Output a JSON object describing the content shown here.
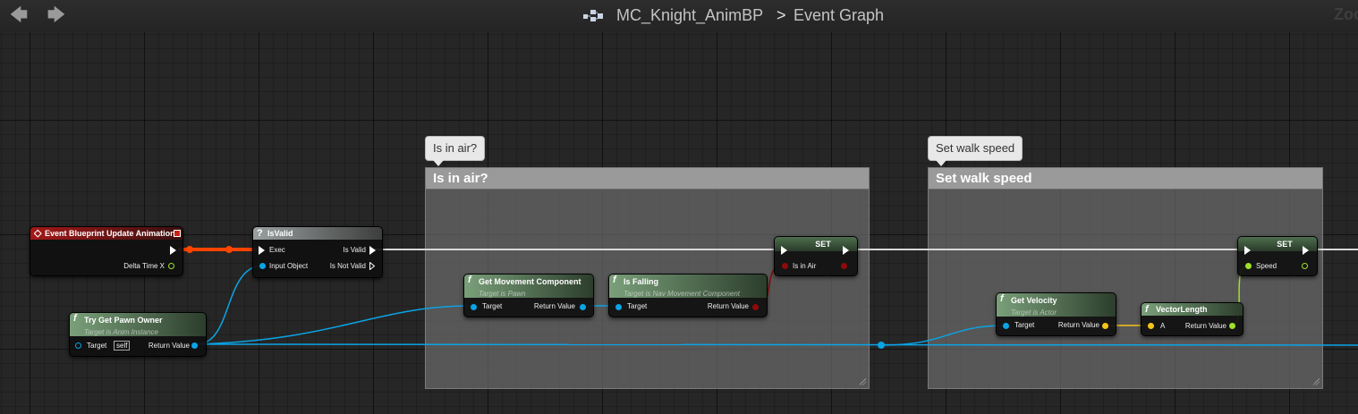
{
  "toolbar": {
    "back_icon": "back-arrow-icon",
    "forward_icon": "forward-arrow-icon",
    "breadcrumb": {
      "blueprint_icon": "blueprint-icon",
      "asset": "MC_Knight_AnimBP",
      "separator": ">",
      "graph": "Event Graph"
    },
    "zoom_text": "Zoo"
  },
  "comments": [
    {
      "bubble": "Is in air?",
      "title": "Is in air?"
    },
    {
      "bubble": "Set walk speed",
      "title": "Set walk speed"
    }
  ],
  "nodes": {
    "event": {
      "title": "Event Blueprint Update Animation",
      "pin_delta": "Delta Time X"
    },
    "isvalid": {
      "icon": "?",
      "title": "IsValid",
      "pin_exec": "Exec",
      "pin_input": "Input Object",
      "pin_valid": "Is Valid",
      "pin_not_valid": "Is Not Valid"
    },
    "pawn_owner": {
      "icon": "f",
      "title": "Try Get Pawn Owner",
      "subtitle": "Target is Anim Instance",
      "pin_target": "Target",
      "self_label": "self",
      "pin_return": "Return Value"
    },
    "get_movement": {
      "icon": "f",
      "title": "Get Movement Component",
      "subtitle": "Target is Pawn",
      "pin_target": "Target",
      "pin_return": "Return Value"
    },
    "is_falling": {
      "icon": "f",
      "title": "Is Falling",
      "subtitle": "Target is Nav Movement Component",
      "pin_target": "Target",
      "pin_return": "Return Value"
    },
    "set_air": {
      "title": "SET",
      "pin_var": "Is in Air"
    },
    "get_velocity": {
      "icon": "f",
      "title": "Get Velocity",
      "subtitle": "Target is Actor",
      "pin_target": "Target",
      "pin_return": "Return Value"
    },
    "vector_length": {
      "icon": "f",
      "title": "VectorLength",
      "pin_a": "A",
      "pin_return": "Return Value"
    },
    "set_speed": {
      "title": "SET",
      "pin_var": "Speed"
    }
  },
  "colors": {
    "exec_wire": "#ffffff",
    "object_wire": "#0aa4e6",
    "bool_pin": "#8e0a0a",
    "float_pin": "#9ee02a",
    "vector_pin": "#f5c418",
    "event_wire": "#ff4400"
  }
}
